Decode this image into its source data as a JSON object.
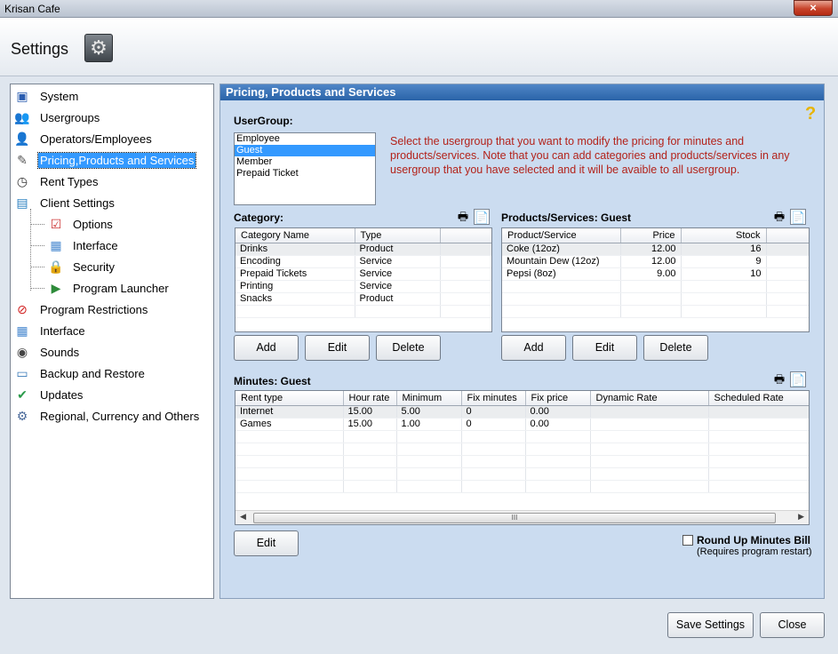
{
  "window": {
    "title": "Krisan Cafe",
    "close_label": "×"
  },
  "header": {
    "title": "Settings",
    "icon": "gear-icon"
  },
  "sidebar": {
    "items": [
      {
        "label": "System",
        "icon": "monitor-icon"
      },
      {
        "label": "Usergroups",
        "icon": "users-icon"
      },
      {
        "label": "Operators/Employees",
        "icon": "employee-icon"
      },
      {
        "label": "Pricing,Products and Services",
        "icon": "pricing-icon",
        "selected": true
      },
      {
        "label": "Rent Types",
        "icon": "clock-icon"
      },
      {
        "label": "Client Settings",
        "icon": "client-settings-icon"
      },
      {
        "label": "Options",
        "icon": "options-icon",
        "sub": true
      },
      {
        "label": "Interface",
        "icon": "interface-icon",
        "sub": true
      },
      {
        "label": "Security",
        "icon": "lock-icon",
        "sub": true
      },
      {
        "label": "Program Launcher",
        "icon": "launcher-icon",
        "sub": true
      },
      {
        "label": "Program Restrictions",
        "icon": "restriction-icon"
      },
      {
        "label": "Interface",
        "icon": "interface-icon"
      },
      {
        "label": "Sounds",
        "icon": "speaker-icon"
      },
      {
        "label": "Backup and Restore",
        "icon": "backup-icon"
      },
      {
        "label": "Updates",
        "icon": "updates-icon"
      },
      {
        "label": "Regional, Currency and Others",
        "icon": "regional-icon"
      }
    ]
  },
  "panel": {
    "title": "Pricing, Products and Services",
    "help_label": "?",
    "usergroup": {
      "label": "UserGroup:",
      "options": [
        "Employee",
        "Guest",
        "Member",
        "Prepaid Ticket"
      ],
      "selected": "Guest"
    },
    "note": "Select the usergroup that you want to modify  the pricing for minutes and products/services. Note that you can add categories and products/services in any usergroup that you have selected and it will be avaible to all usergroup.",
    "category": {
      "label": "Category:",
      "columns": [
        "Category Name",
        "Type",
        ""
      ],
      "rows": [
        [
          "Drinks",
          "Product"
        ],
        [
          "Encoding",
          "Service"
        ],
        [
          "Prepaid Tickets",
          "Service"
        ],
        [
          "Printing",
          "Service"
        ],
        [
          "Snacks",
          "Product"
        ]
      ],
      "buttons": {
        "add": "Add",
        "edit": "Edit",
        "delete": "Delete"
      }
    },
    "products": {
      "label": "Products/Services: Guest",
      "columns": [
        "Product/Service",
        "Price",
        "Stock",
        ""
      ],
      "rows": [
        [
          "Coke (12oz)",
          "12.00",
          "16"
        ],
        [
          "Mountain Dew (12oz)",
          "12.00",
          "9"
        ],
        [
          "Pepsi (8oz)",
          "9.00",
          "10"
        ]
      ],
      "buttons": {
        "add": "Add",
        "edit": "Edit",
        "delete": "Delete"
      }
    },
    "minutes": {
      "label": "Minutes: Guest",
      "columns": [
        "Rent type",
        "Hour rate",
        "Minimum",
        "Fix minutes",
        "Fix price",
        "Dynamic Rate",
        "Scheduled Rate"
      ],
      "rows": [
        [
          "Internet",
          "15.00",
          "5.00",
          "0",
          "0.00",
          "",
          ""
        ],
        [
          "Games",
          "15.00",
          "1.00",
          "0",
          "0.00",
          "",
          ""
        ]
      ],
      "edit_label": "Edit",
      "scroll_grip": "III"
    },
    "round_up": {
      "label": "Round Up Minutes Bill",
      "note": "(Requires program restart)",
      "checked": false
    }
  },
  "footer": {
    "save_label": "Save Settings",
    "close_label": "Close"
  }
}
